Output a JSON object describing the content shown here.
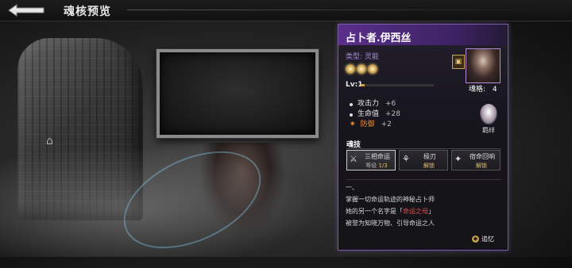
{
  "header": {
    "title": "魂核预览",
    "back_icon": "back-arrow-icon"
  },
  "character": {
    "name": "占卜者.伊西丝",
    "type_label": "类型:",
    "type_value": "灵能",
    "stars": 3,
    "level": "Lv:1",
    "level_progress": 0.05,
    "soul_grade_label": "魂格:",
    "soul_grade_value": "4"
  },
  "stats": [
    {
      "name": "攻击力",
      "value": "+6",
      "special": false
    },
    {
      "name": "生命值",
      "value": "+28",
      "special": false
    },
    {
      "name": "防御",
      "value": "+2",
      "special": true
    }
  ],
  "aura": {
    "label": "羁绊"
  },
  "skills": {
    "title": "魂技",
    "items": [
      {
        "name": "三相命运",
        "sub_label": "等级",
        "sub_value": "1/3",
        "active": true
      },
      {
        "name": "极刃",
        "sub_label": "",
        "sub_value": "解锁",
        "active": false
      },
      {
        "name": "宿命回响",
        "sub_label": "",
        "sub_value": "解锁",
        "active": false
      }
    ]
  },
  "description": {
    "line1": "一、",
    "line2": "掌握一切命运轨迹的神秘占卜师",
    "line3_prefix": "她的另一个名字是「",
    "line3_highlight": "命运之母",
    "line3_suffix": "」",
    "line4": "被誉为知晓万物、引导命运之人"
  },
  "recall": {
    "label": "追忆"
  },
  "colors": {
    "panel_accent": "#7a5aa8",
    "header_purple": "#5a2f8c",
    "highlight_red": "#e05050",
    "gold": "#c9a04c"
  }
}
